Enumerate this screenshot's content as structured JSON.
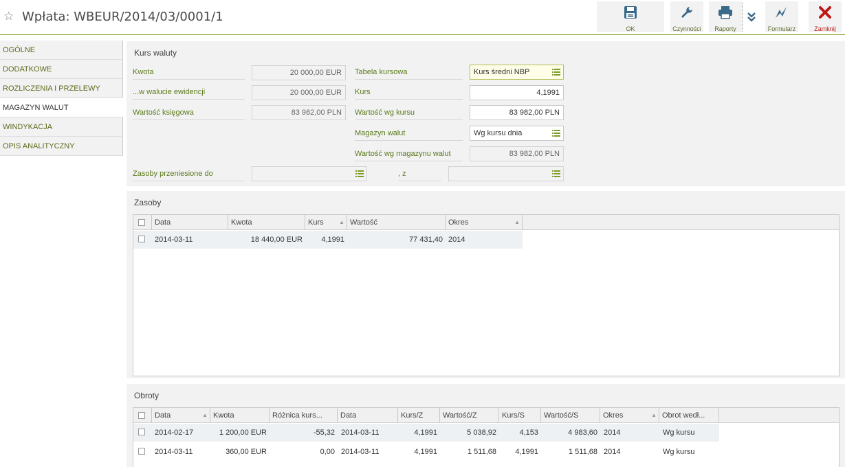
{
  "window": {
    "title": "Wpłata: WBEUR/2014/03/0001/1"
  },
  "toolbar": {
    "ok": "OK",
    "actions": "Czynności",
    "reports": "Raporty",
    "form": "Formularz",
    "close": "Zamknij"
  },
  "nav": {
    "items": [
      {
        "label": "OGÓLNE"
      },
      {
        "label": "DODATKOWE"
      },
      {
        "label": "ROZLICZENIA I PRZELEWY"
      },
      {
        "label": "MAGAZYN WALUT"
      },
      {
        "label": "WINDYKACJA"
      },
      {
        "label": "OPIS ANALITYCZNY"
      }
    ],
    "active": "MAGAZYN WALUT"
  },
  "kurs": {
    "section_title": "Kurs waluty",
    "kwota_label": "Kwota",
    "kwota_value": "20 000,00 EUR",
    "waluta_ewidencji_label": "...w walucie ewidencji",
    "waluta_ewidencji_value": "20 000,00 EUR",
    "wartosc_ksiegowa_label": "Wartość księgowa",
    "wartosc_ksiegowa_value": "83 982,00 PLN",
    "tabela_kursowa_label": "Tabela kursowa",
    "tabela_kursowa_value": "Kurs średni NBP",
    "kurs_label": "Kurs",
    "kurs_value": "4,1991",
    "wartosc_wg_kursu_label": "Wartość wg kursu",
    "wartosc_wg_kursu_value": "83 982,00 PLN",
    "magazyn_walut_label": "Magazyn walut",
    "magazyn_walut_value": "Wg kursu dnia",
    "wartosc_wg_magazynu_label": "Wartość wg magazynu walut",
    "wartosc_wg_magazynu_value": "83 982,00 PLN",
    "zasoby_przeniesione_label": "Zasoby przeniesione do",
    "zasoby_przeniesione_value": "",
    "z_label": ", z",
    "z_value": ""
  },
  "zasoby": {
    "section_title": "Zasoby",
    "columns": [
      "Data",
      "Kwota",
      "Kurs",
      "Wartość",
      "Okres"
    ],
    "rows": [
      {
        "data": "2014-03-11",
        "kwota": "18 440,00 EUR",
        "kurs": "4,1991",
        "wartosc": "77 431,40",
        "okres": "2014"
      }
    ]
  },
  "obroty": {
    "section_title": "Obroty",
    "columns": [
      "Data",
      "Kwota",
      "Różnica kurs...",
      "Data",
      "Kurs/Z",
      "Wartość/Z",
      "Kurs/S",
      "Wartość/S",
      "Okres",
      "Obrot wedł..."
    ],
    "rows": [
      {
        "data": "2014-02-17",
        "kwota": "1 200,00 EUR",
        "roznica": "-55,32",
        "data2": "2014-03-11",
        "kurs_z": "4,1991",
        "wartosc_z": "5 038,92",
        "kurs_s": "4,153",
        "wartosc_s": "4 983,60",
        "okres": "2014",
        "obrot": "Wg kursu"
      },
      {
        "data": "2014-03-11",
        "kwota": "360,00 EUR",
        "roznica": "0,00",
        "data2": "2014-03-11",
        "kurs_z": "4,1991",
        "wartosc_z": "1 511,68",
        "kurs_s": "4,1991",
        "wartosc_s": "1 511,68",
        "okres": "2014",
        "obrot": "Wg kursu"
      }
    ]
  },
  "colors": {
    "accent": "#8aa83a",
    "label_green": "#5a7a1a",
    "close_red": "#c01818",
    "icon_blue": "#3a6a8a"
  }
}
